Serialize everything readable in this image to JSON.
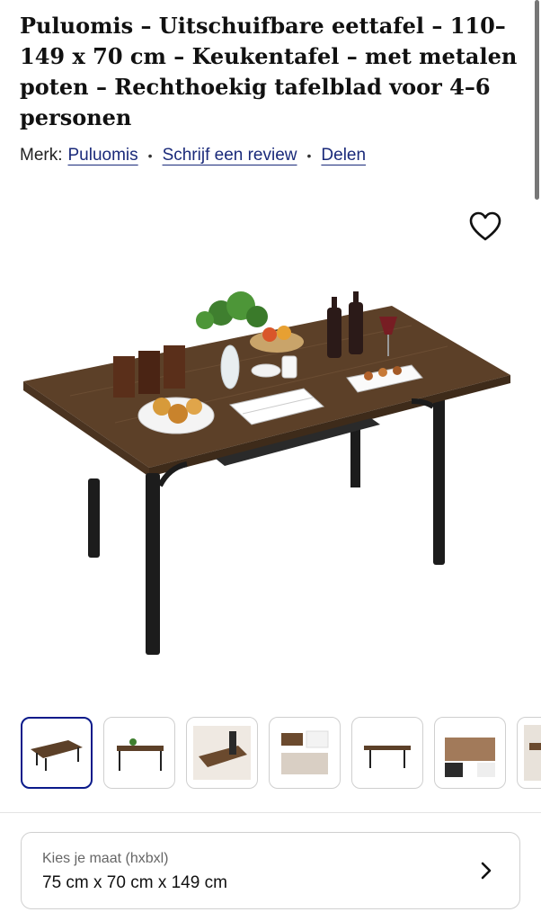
{
  "product": {
    "title": "Puluomis – Uitschuifbare eettafel – 110–149 x 70 cm – Keukentafel – met metalen poten – Rechthoekig tafelblad voor 4–6 personen",
    "brand_prefix": "Merk:",
    "brand": "Puluomis",
    "review_link": "Schrijf een review",
    "share_link": "Delen",
    "separator": "•"
  },
  "gallery": {
    "favorite_icon": "heart-outline-icon",
    "thumbnail_count": 7,
    "selected_thumbnail": 1
  },
  "size_selector": {
    "label": "Kies je maat (hxbxl)",
    "value": "75 cm x 70 cm x 149 cm",
    "icon": "chevron-right-icon"
  },
  "colors": {
    "brand_link": "#1a2a7a",
    "selected_border": "#0a1a8a",
    "table_top": "#5c4028",
    "table_legs": "#1c1c1c"
  }
}
